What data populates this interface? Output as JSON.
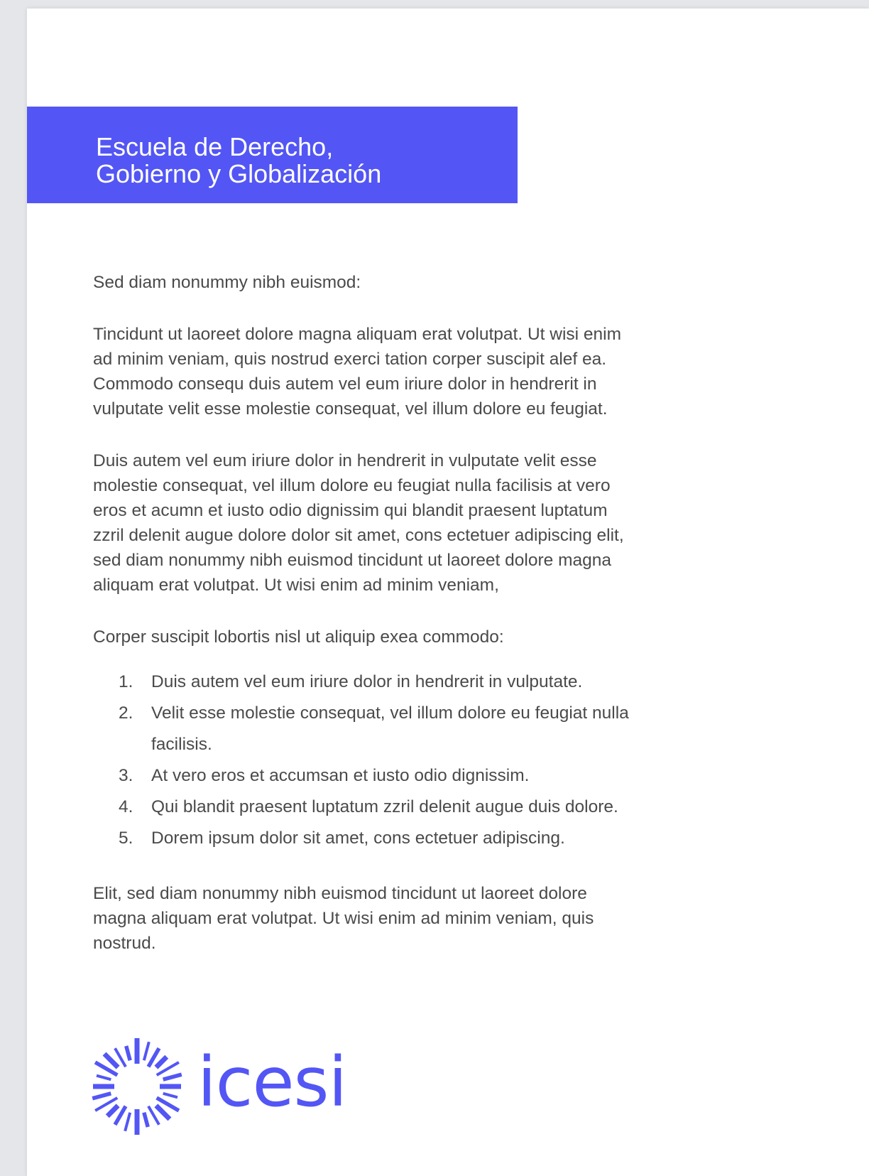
{
  "header": {
    "line1": "Escuela de Derecho,",
    "line2": "Gobierno y Globalización",
    "band_color": "#5356f4"
  },
  "body": {
    "intro": "Sed diam nonummy nibh euismod:",
    "paragraph1": [
      "Tincidunt ut laoreet dolore magna aliquam erat volutpat. Ut wisi enim",
      "ad minim veniam, quis nostrud exerci tation corper suscipit  alef ea.",
      "Commodo consequ duis autem vel eum iriure dolor in hendrerit in",
      "vulputate velit esse molestie consequat, vel illum dolore eu feugiat."
    ],
    "paragraph2": [
      "Duis autem vel eum iriure dolor in hendrerit in vulputate velit esse",
      "molestie consequat, vel illum dolore eu feugiat nulla facilisis at vero",
      "eros et acumn et iusto odio dignissim qui blandit praesent luptatum",
      "zzril delenit augue dolore dolor sit amet, cons ectetuer adipiscing elit,",
      "sed diam nonummy nibh euismod tincidunt ut laoreet dolore magna",
      "aliquam erat volutpat. Ut wisi enim ad minim veniam,"
    ],
    "list_intro": "Corper suscipit lobortis nisl ut aliquip exea commodo:",
    "list_items": [
      {
        "number": "1.",
        "line1": "Duis autem vel eum iriure dolor in hendrerit in vulputate.",
        "line2": ""
      },
      {
        "number": "2.",
        "line1": "Velit esse molestie consequat, vel illum dolore eu feugiat nulla",
        "line2": "facilisis."
      },
      {
        "number": "3.",
        "line1": "At vero eros et accumsan et iusto odio dignissim.",
        "line2": ""
      },
      {
        "number": "4.",
        "line1": "Qui blandit praesent luptatum zzril delenit augue duis dolore.",
        "line2": ""
      },
      {
        "number": "5.",
        "line1": "Dorem ipsum dolor sit amet, cons ectetuer adipiscing.",
        "line2": ""
      }
    ],
    "closing": [
      "Elit, sed diam nonummy nibh euismod tincidunt ut laoreet dolore",
      "magna aliquam erat volutpat. Ut wisi enim ad minim veniam, quis",
      "nostrud."
    ]
  },
  "logo": {
    "wordmark": "icesi",
    "icon": "sunburst-icon",
    "color": "#5356f4"
  }
}
